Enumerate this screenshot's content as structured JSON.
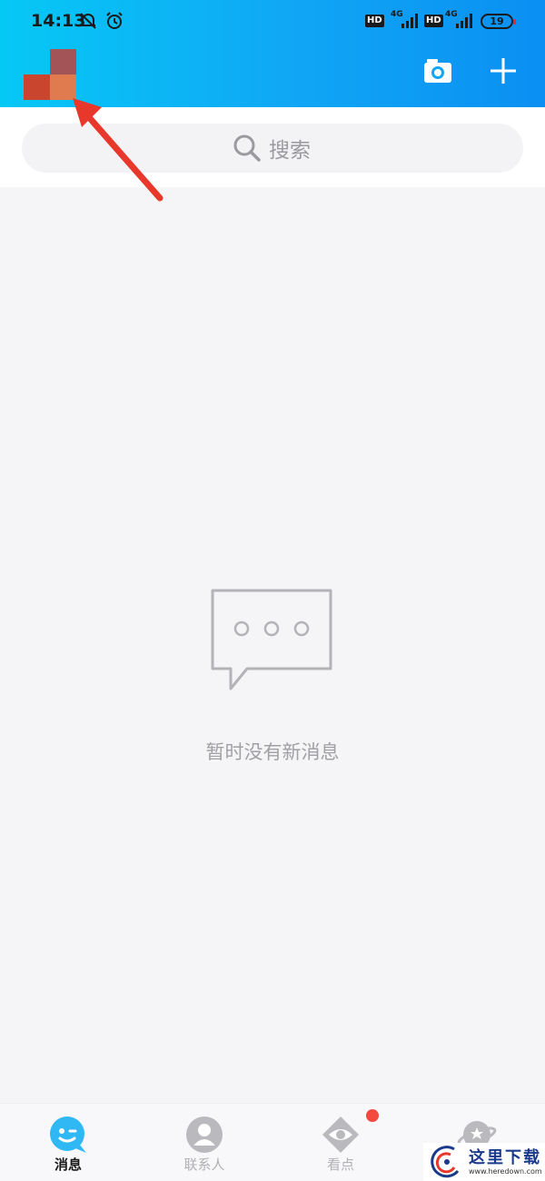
{
  "status_bar": {
    "time": "14:13",
    "hd1": "HD",
    "net1": "4G",
    "hd2": "HD",
    "net2": "4G",
    "battery": "19"
  },
  "header": {
    "camera_icon": "camera-icon",
    "plus_icon": "plus-icon"
  },
  "search": {
    "label": "搜索"
  },
  "empty_state": {
    "message": "暂时没有新消息"
  },
  "tabs": [
    {
      "label": "消息",
      "icon": "chat-face-icon",
      "active": true
    },
    {
      "label": "联系人",
      "icon": "contact-icon",
      "active": false
    },
    {
      "label": "看点",
      "icon": "eye-icon",
      "active": false,
      "badge": true
    },
    {
      "label": "",
      "icon": "planet-icon",
      "active": false
    }
  ],
  "watermark": {
    "text": "这里下载",
    "url": "www.heredown.com"
  },
  "colors": {
    "header_start": "#06c8f5",
    "header_end": "#0a8ff2",
    "annotation_arrow": "#e8372b",
    "badge_red": "#f24a3f"
  }
}
